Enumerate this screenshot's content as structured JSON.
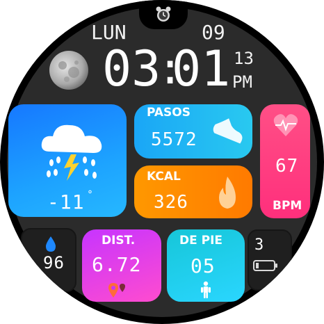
{
  "watch": {
    "day": "LUN",
    "date": "09",
    "time_h": "03",
    "time_sep": ":",
    "time_m": "01",
    "seconds": "13",
    "ampm": "PM",
    "weather_temp": "-11",
    "weather_unit": "°",
    "steps_label": "PASOS",
    "steps_value": "5572",
    "kcal_label": "KCAL",
    "kcal_value": "326",
    "heart_value": "67",
    "heart_unit": "BPM",
    "humidity_value": "96",
    "dist_label": "DIST.",
    "dist_value": "6.72",
    "stand_label": "DE PIE",
    "stand_value": "05",
    "battery_value": "3"
  },
  "colors": {
    "weather_tile": "#1e7bff",
    "steps_tile": "#1db7f0",
    "kcal_tile": "#ff8a00",
    "heart_tile": "#ff3c86",
    "dist_tile": "#c02bff",
    "stand_tile": "#18c6d6"
  },
  "icons": [
    "alarm-icon",
    "moon-icon",
    "cloud-thunder-rain-icon",
    "shoe-icon",
    "flame-icon",
    "heart-icon",
    "water-drop-icon",
    "location-pin-icon",
    "person-icon",
    "battery-icon"
  ]
}
